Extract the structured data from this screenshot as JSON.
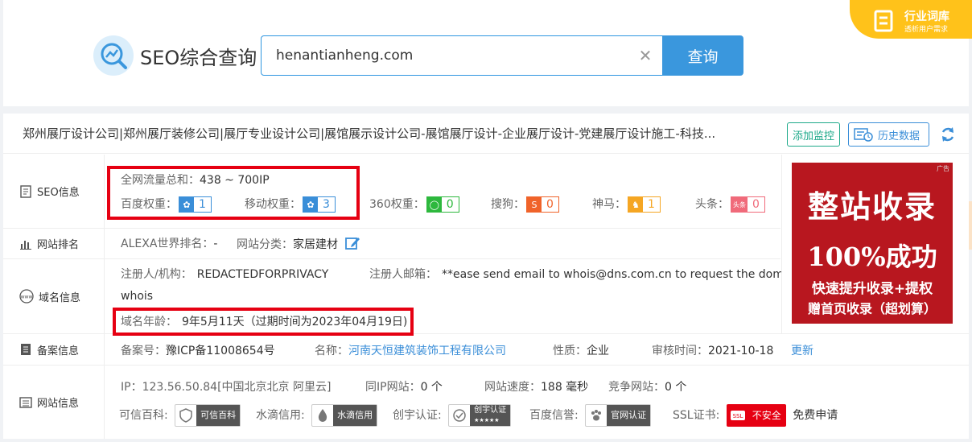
{
  "header": {
    "app_title": "SEO综合查询",
    "search_value": "henantianheng.com",
    "search_button": "查询",
    "ad_title": "行业词库",
    "ad_subtitle": "透析用户需求"
  },
  "summary": {
    "page_title": "郑州展厅设计公司|郑州展厅装修公司|展厅专业设计公司|展馆展示设计公司-展馆展厅设计-企业展厅设计-党建展厅设计施工-科技...",
    "add_monitor": "添加监控",
    "history": "历史数据"
  },
  "seo": {
    "label": "SEO信息",
    "traffic_label": "全网流量总和：",
    "traffic_value": "438 ~ 700IP",
    "baidu_label": "百度权重：",
    "baidu_value": "1",
    "mobile_label": "移动权重：",
    "mobile_value": "3",
    "s360_label": "360权重：",
    "s360_value": "0",
    "sogou_label": "搜狗：",
    "sogou_value": "0",
    "shenma_label": "神马：",
    "shenma_value": "1",
    "toutiao_label": "头条：",
    "toutiao_value": "0",
    "toutiao_icon_text": "头条"
  },
  "rank": {
    "label": "网站排名",
    "alexa_label": "ALEXA世界排名：",
    "alexa_value": "-",
    "category_label": "网站分类：",
    "category_value": "家居建材"
  },
  "domain": {
    "label": "域名信息",
    "registrant_label": "注册人/机构：",
    "registrant_value": "REDACTEDFORPRIVACY",
    "email_label": "注册人邮箱：",
    "email_value": "**ease send email to whois@dns.com.cn to request the domain",
    "whois": "whois",
    "age_label": "域名年龄：",
    "age_value": "9年5月11天（过期时间为2023年04月19日)"
  },
  "icp": {
    "label": "备案信息",
    "no_label": "备案号：",
    "no_value": "豫ICP备11008654号",
    "name_label": "名称：",
    "name_value": "河南天恒建筑装饰工程有限公司",
    "nature_label": "性质：",
    "nature_value": "企业",
    "review_label": "审核时间：",
    "review_value": "2021-10-18",
    "update": "更新"
  },
  "site": {
    "label": "网站信息",
    "ip_label": "IP：",
    "ip_value": "123.56.50.84[中国北京北京 阿里云]",
    "same_ip_label": "同IP网站：",
    "same_ip_value": "0 个",
    "speed_label": "网站速度：",
    "speed_value": "188 毫秒",
    "compete_label": "竞争网站：",
    "compete_value": "0 个",
    "kexin_label": "可信百科:",
    "kexin_badge": "可信百科",
    "shuidi_label": "水滴信用:",
    "shuidi_badge": "水滴信用",
    "chuangyu_label": "创宇认证:",
    "chuangyu_badge": "创宇认证",
    "chuangyu_stars": "★★★★★",
    "baiduxy_label": "百度信誉:",
    "baiduxy_badge": "官网认证",
    "ssl_label": "SSL证书:",
    "ssl_icon_text": "SSL",
    "ssl_badge": "不安全",
    "ssl_apply": "免费申请"
  },
  "ad": {
    "line1": "整站收录",
    "line2": "100%成功",
    "line3": "快速提升收录+提权",
    "line4": "赠首页收录（超划算）",
    "tag": "广告"
  },
  "colors": {
    "accent": "#3a97dd",
    "green": "#1ea98a",
    "red_box": "#e60012",
    "ad_bg": "#b8171f",
    "corner_ad": "#ffc21a"
  }
}
